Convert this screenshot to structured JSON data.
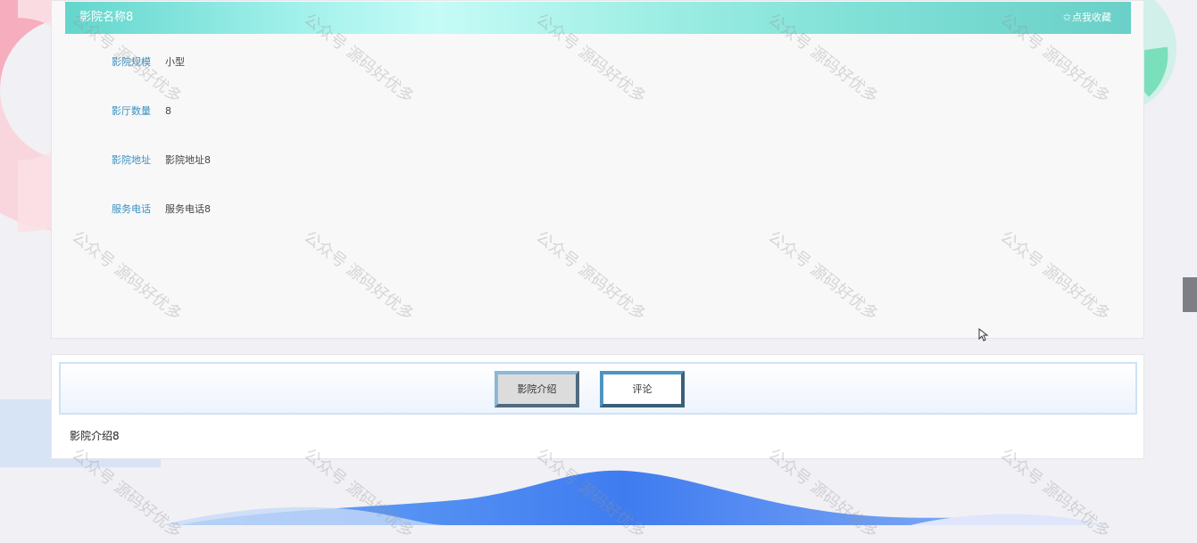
{
  "cinema": {
    "title": "影院名称8",
    "favorite_label": "点我收藏",
    "fields": [
      {
        "label": "影院规模",
        "value": "小型"
      },
      {
        "label": "影厅数量",
        "value": "8"
      },
      {
        "label": "影院地址",
        "value": "影院地址8"
      },
      {
        "label": "服务电话",
        "value": "服务电话8"
      }
    ]
  },
  "tabs": {
    "items": [
      {
        "label": "影院介绍",
        "active": true
      },
      {
        "label": "评论",
        "active": false
      }
    ],
    "content": "影院介绍8"
  },
  "watermark": {
    "text": "公众号 源码好优多"
  },
  "colors": {
    "title_bar": "#7fe0d6",
    "field_label": "#3b8fbf",
    "wave": "#4d86f0"
  }
}
